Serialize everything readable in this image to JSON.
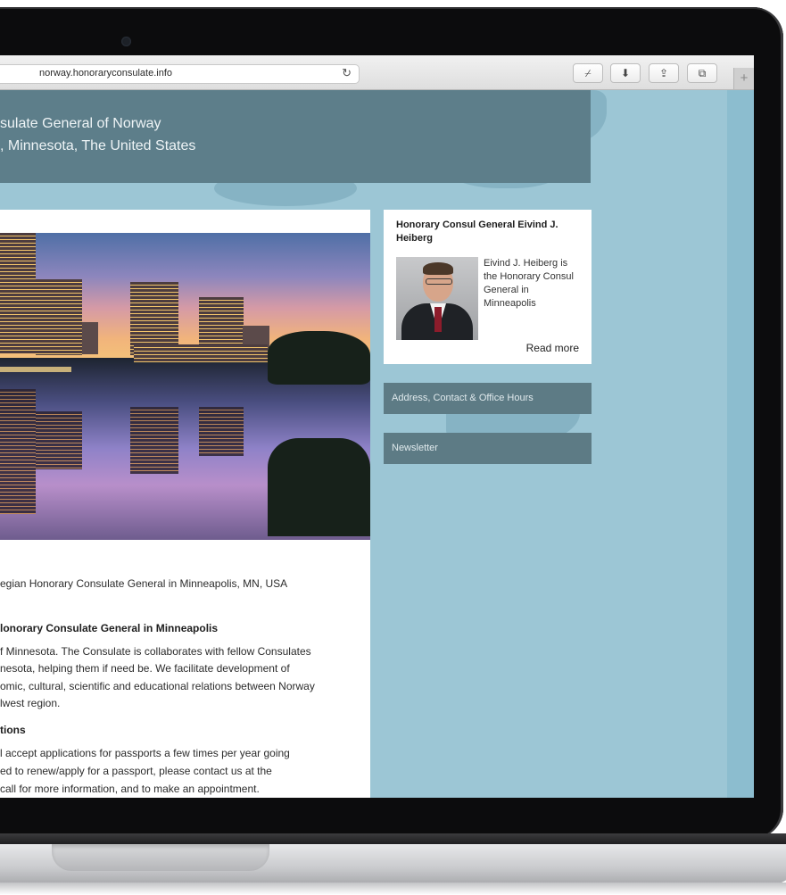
{
  "browser": {
    "url": "norway.honoraryconsulate.info",
    "reload_icon": "reload-icon",
    "toolbar_icons": [
      "pin-icon",
      "download-icon",
      "share-icon",
      "tabs-icon"
    ],
    "new_tab_label": "+"
  },
  "header": {
    "line1": "sulate General of Norway",
    "line2": ", Minnesota, The United States"
  },
  "main": {
    "intro": "egian Honorary Consulate General in Minneapolis, MN, USA",
    "section1_heading": "lonorary Consulate General in Minneapolis",
    "section1_lines": [
      "f Minnesota. The Consulate is collaborates with fellow Consulates",
      "nesota, helping them if need be. We facilitate development of",
      "omic, cultural, scientific and educational relations between Norway",
      "lwest region."
    ],
    "section2_heading": "tions",
    "section2_lines": [
      "l accept applications for passports a few times per year going",
      "ed to renew/apply for a passport, please contact us at the",
      " call for more information, and to make an appointment."
    ]
  },
  "sidebar": {
    "consul_title": "Honorary Consul General Eivind J. Heiberg",
    "consul_bio": "Eivind J. Heiberg is the Honorary Consul General in Minneapolis",
    "read_more": "Read more",
    "address_label": "Address, Contact & Office Hours",
    "newsletter_label": "Newsletter"
  },
  "colors": {
    "page_background": "#9cc6d5",
    "header_background": "#5d7e8a",
    "sidebar_bar": "#5d7b85"
  }
}
